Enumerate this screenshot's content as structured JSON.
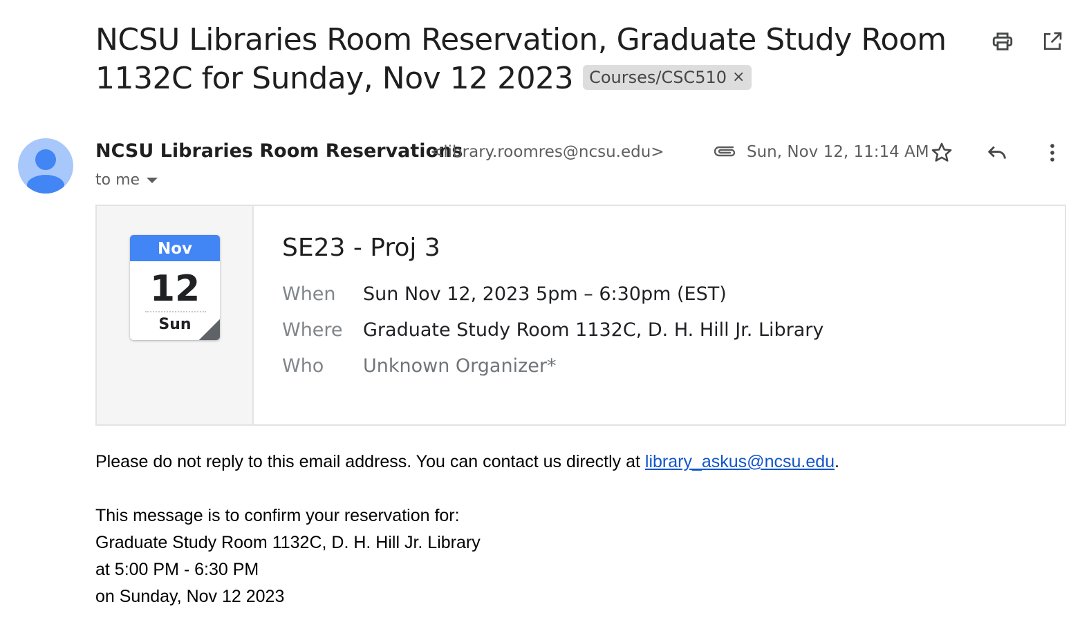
{
  "subject": {
    "text": "NCSU Libraries Room Reservation, Graduate Study Room 1132C for Sunday, Nov 12 2023",
    "label": "Courses/CSC510",
    "label_remove": "×"
  },
  "toolbar": {
    "print_icon": "print-icon",
    "open_new_window_icon": "open-in-new-icon"
  },
  "message": {
    "sender_name": "NCSU Libraries Room Reservations",
    "sender_email": "<library.roomres@ncsu.edu>",
    "date": "Sun, Nov 12, 11:14 AM",
    "recipients": "to me",
    "attachment_icon": "paperclip-icon",
    "star_icon": "star-icon",
    "reply_icon": "reply-icon",
    "more_icon": "more-vert-icon"
  },
  "event": {
    "calendar": {
      "month": "Nov",
      "day": "12",
      "weekday": "Sun"
    },
    "title": "SE23 - Proj 3",
    "when_label": "When",
    "when_value": "Sun Nov 12, 2023 5pm – 6:30pm (EST)",
    "where_label": "Where",
    "where_value": "Graduate Study Room 1132C, D. H. Hill Jr. Library",
    "who_label": "Who",
    "who_value": "Unknown Organizer*"
  },
  "body": {
    "line1_prefix": "Please do not reply to this email address. You can contact us directly at ",
    "line1_link": "library_askus@ncsu.edu",
    "line1_suffix": ".",
    "line2": "This message is to confirm your reservation for:",
    "line3": "Graduate Study Room 1132C, D. H. Hill Jr. Library",
    "line4": "at 5:00 PM - 6:30 PM",
    "line5": "on Sunday, Nov 12 2023"
  },
  "colors": {
    "link": "#1155cc",
    "calendar_header": "#4285f4",
    "avatar_bg": "#a8c7fa",
    "avatar_fg": "#4285f4",
    "label_chip_bg": "#dddddd"
  }
}
